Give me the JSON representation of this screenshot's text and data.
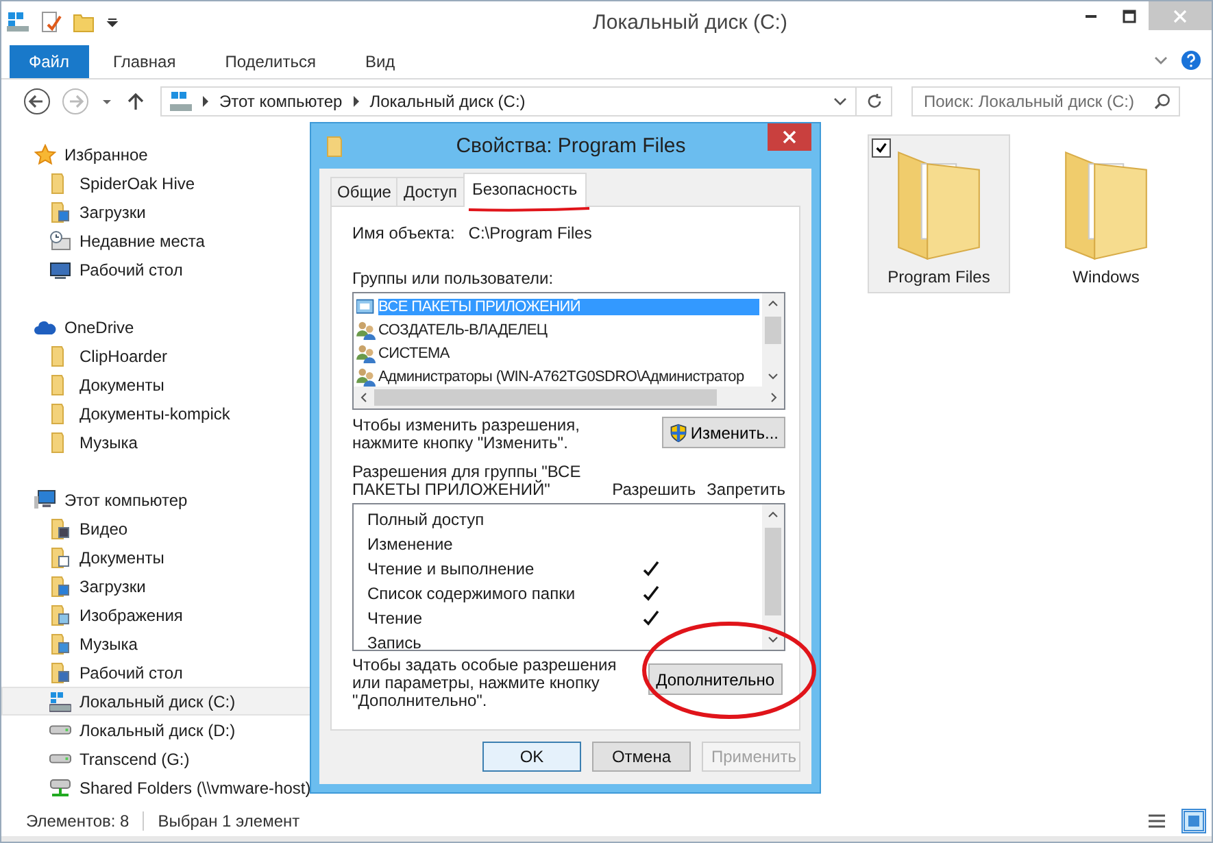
{
  "window": {
    "title": "Локальный диск (C:)"
  },
  "ribbon_tabs": [
    {
      "label": "Файл",
      "selected": true
    },
    {
      "label": "Главная",
      "selected": false
    },
    {
      "label": "Поделиться",
      "selected": false
    },
    {
      "label": "Вид",
      "selected": false
    }
  ],
  "address": {
    "path": [
      "Этот компьютер",
      "Локальный диск (C:)"
    ]
  },
  "search": {
    "placeholder": "Поиск: Локальный диск (C:)"
  },
  "sidebar": {
    "groups": [
      {
        "label": "Избранное",
        "kind": "favorites",
        "children": [
          {
            "label": "SpiderOak Hive",
            "kind": "folder",
            "selected": false
          },
          {
            "label": "Загрузки",
            "kind": "downloads",
            "selected": false
          },
          {
            "label": "Недавние места",
            "kind": "recent",
            "selected": false
          },
          {
            "label": "Рабочий стол",
            "kind": "desktop",
            "selected": false
          }
        ]
      },
      {
        "label": "OneDrive",
        "kind": "cloud",
        "children": [
          {
            "label": "ClipHoarder",
            "kind": "folder",
            "selected": false
          },
          {
            "label": "Документы",
            "kind": "folder",
            "selected": false
          },
          {
            "label": "Документы-kompick",
            "kind": "folder",
            "selected": false
          },
          {
            "label": "Музыка",
            "kind": "folder",
            "selected": false
          }
        ]
      },
      {
        "label": "Этот компьютер",
        "kind": "computer",
        "children": [
          {
            "label": "Видео",
            "kind": "video",
            "selected": false
          },
          {
            "label": "Документы",
            "kind": "documents",
            "selected": false
          },
          {
            "label": "Загрузки",
            "kind": "downloads",
            "selected": false
          },
          {
            "label": "Изображения",
            "kind": "pictures",
            "selected": false
          },
          {
            "label": "Музыка",
            "kind": "music",
            "selected": false
          },
          {
            "label": "Рабочий стол",
            "kind": "desktop-folder",
            "selected": false
          },
          {
            "label": "Локальный диск (C:)",
            "kind": "system-drive",
            "selected": true
          },
          {
            "label": "Локальный диск (D:)",
            "kind": "drive",
            "selected": false
          },
          {
            "label": "Transcend (G:)",
            "kind": "drive",
            "selected": false
          },
          {
            "label": "Shared Folders (\\\\vmware-host)",
            "kind": "network-drive",
            "selected": false
          }
        ]
      }
    ]
  },
  "files": [
    {
      "name": "Program Files",
      "selected": true,
      "checked": true
    },
    {
      "name": "Windows",
      "selected": false,
      "checked": false
    }
  ],
  "status_bar": {
    "count": "Элементов: 8",
    "selection": "Выбран 1 элемент"
  },
  "dialog": {
    "title": "Свойства: Program Files",
    "tabs": [
      {
        "label": "Общие",
        "selected": false
      },
      {
        "label": "Доступ",
        "selected": false
      },
      {
        "label": "Безопасность",
        "selected": true
      }
    ],
    "object_label": "Имя объекта:",
    "object_value": "C:\\Program Files",
    "groups_label": "Группы или пользователи:",
    "users": [
      {
        "name": "ВСЕ ПАКЕТЫ ПРИЛОЖЕНИЙ",
        "kind": "package",
        "selected": true
      },
      {
        "name": "СОЗДАТЕЛЬ-ВЛАДЕЛЕЦ",
        "kind": "users",
        "selected": false
      },
      {
        "name": "СИСТЕМА",
        "kind": "users",
        "selected": false
      },
      {
        "name": "Администраторы (WIN-A762TG0SDRO\\Администратор",
        "kind": "users",
        "selected": false
      }
    ],
    "change_hint": "Чтобы изменить разрешения, нажмите кнопку \"Изменить\".",
    "change_button": "Изменить...",
    "permissions_label": "Разрешения для группы \"ВСЕ ПАКЕТЫ ПРИЛОЖЕНИЙ\"",
    "allow_header": "Разрешить",
    "deny_header": "Запретить",
    "permissions": [
      {
        "name": "Полный доступ",
        "allow": false,
        "deny": false
      },
      {
        "name": "Изменение",
        "allow": false,
        "deny": false
      },
      {
        "name": "Чтение и выполнение",
        "allow": true,
        "deny": false
      },
      {
        "name": "Список содержимого папки",
        "allow": true,
        "deny": false
      },
      {
        "name": "Чтение",
        "allow": true,
        "deny": false
      },
      {
        "name": "Запись",
        "allow": false,
        "deny": false
      }
    ],
    "advanced_hint": "Чтобы задать особые разрешения или параметры, нажмите кнопку \"Дополнительно\".",
    "advanced_button": "Дополнительно",
    "buttons": [
      {
        "label": "OK",
        "kind": "default",
        "disabled": false
      },
      {
        "label": "Отмена",
        "kind": "normal",
        "disabled": false
      },
      {
        "label": "Применить",
        "kind": "normal",
        "disabled": true
      }
    ]
  }
}
